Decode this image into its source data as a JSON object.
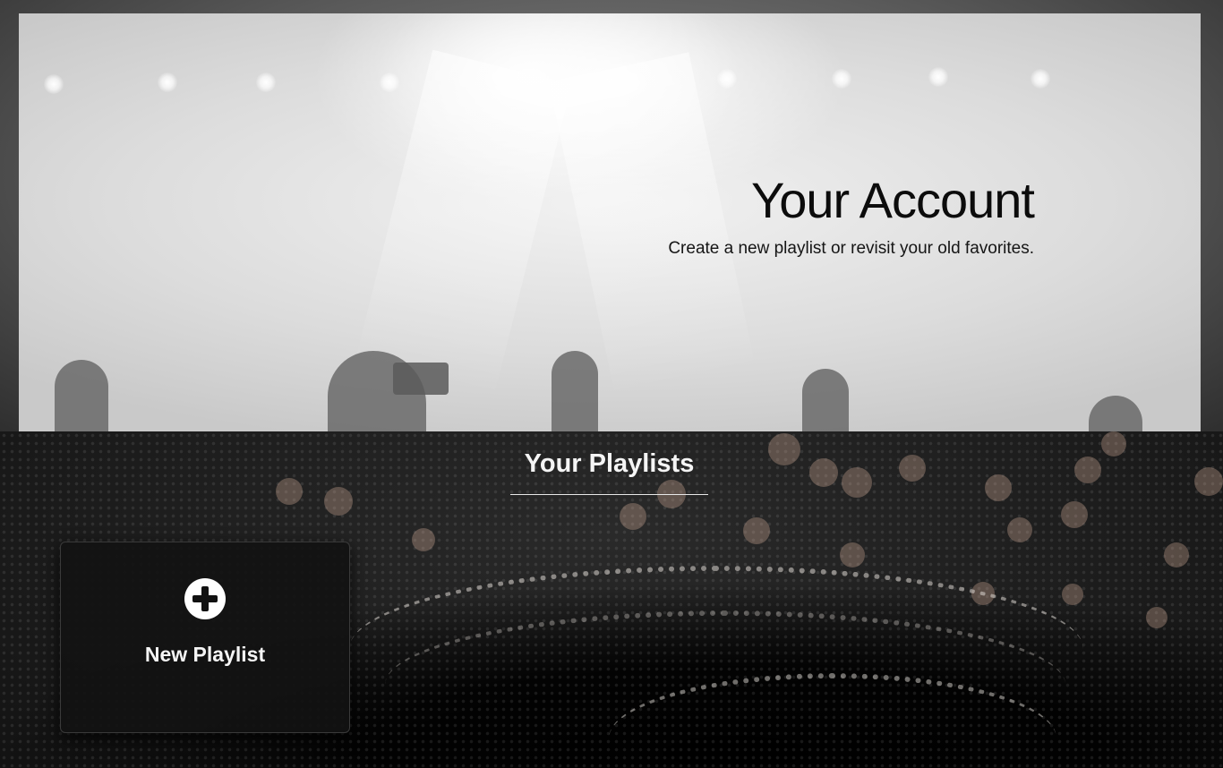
{
  "hero": {
    "title": "Your Account",
    "subtitle": "Create a new playlist or revisit your old favorites."
  },
  "playlists": {
    "heading": "Your Playlists",
    "new_card": {
      "label": "New Playlist",
      "icon": "plus-circle-icon"
    }
  }
}
